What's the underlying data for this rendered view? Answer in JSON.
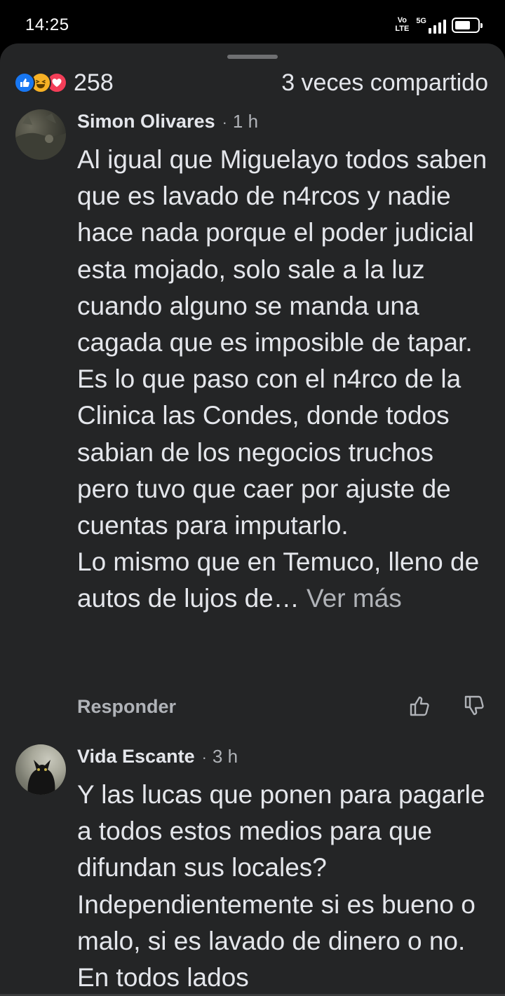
{
  "status_bar": {
    "time": "14:25",
    "volte_top": "Vo",
    "volte_bottom": "LTE",
    "network": "5G",
    "icons": [
      "volte-icon",
      "signal-icon",
      "battery-icon"
    ]
  },
  "summary": {
    "reactions": [
      "like-icon",
      "haha-icon",
      "love-icon"
    ],
    "reaction_count": "258",
    "shares": "3 veces compartido"
  },
  "comments": [
    {
      "author": "Simon Olivares",
      "separator": "·",
      "time": "1 h",
      "paragraphs": [
        "Al igual que Miguelayo todos saben que es lavado de n4rcos y nadie hace nada porque el poder judicial esta mojado, solo sale a la luz cuando alguno se manda una cagada que es imposible de tapar.",
        "Es lo que paso con el n4rco de la Clinica las Condes, donde todos sabian de los negocios truchos pero tuvo que caer por ajuste de cuentas para imputarlo.",
        "Lo mismo que en Temuco, lleno de autos de lujos de…"
      ],
      "see_more": "Ver más",
      "reply_label": "Responder"
    },
    {
      "author": "Vida Escante",
      "separator": "·",
      "time": "3 h",
      "paragraphs": [
        "Y las lucas que ponen para pagarle a todos estos medios para que difundan sus locales? Independientemente si es bueno o malo, si es lavado de dinero o no. En todos lados"
      ]
    }
  ],
  "colors": {
    "sheet_bg": "#242526",
    "text_primary": "#e4e6eb",
    "text_secondary": "#b0b3b8",
    "like_blue": "#1877f2",
    "haha_yellow": "#f7b125",
    "love_red": "#f33e58"
  }
}
